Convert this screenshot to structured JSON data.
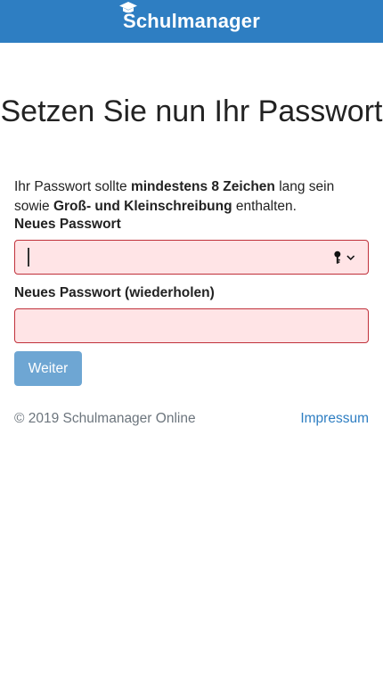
{
  "header": {
    "brand": "Schulmanager",
    "logo_icon": "graduation-cap-icon"
  },
  "title": "Setzen Sie nun Ihr Passwort",
  "intro": {
    "part1": "Ihr Passwort sollte ",
    "bold1": "mindestens 8 Zeichen",
    "part2": " lang sein sowie ",
    "bold2": "Groß- und Kleinschreibung",
    "part3": " enthalten."
  },
  "form": {
    "new_password_label": "Neues Passwort",
    "new_password_value": "",
    "repeat_password_label": "Neues Passwort (wiederholen)",
    "repeat_password_value": "",
    "password_manager_icon": "key-icon",
    "submit_label": "Weiter"
  },
  "footer": {
    "copyright": "© 2019 Schulmanager Online",
    "impressum": "Impressum"
  },
  "colors": {
    "brand": "#2e7ec2",
    "error_border": "#c0303a",
    "error_fill": "#ffe4e6",
    "button": "#6ea6d3"
  }
}
